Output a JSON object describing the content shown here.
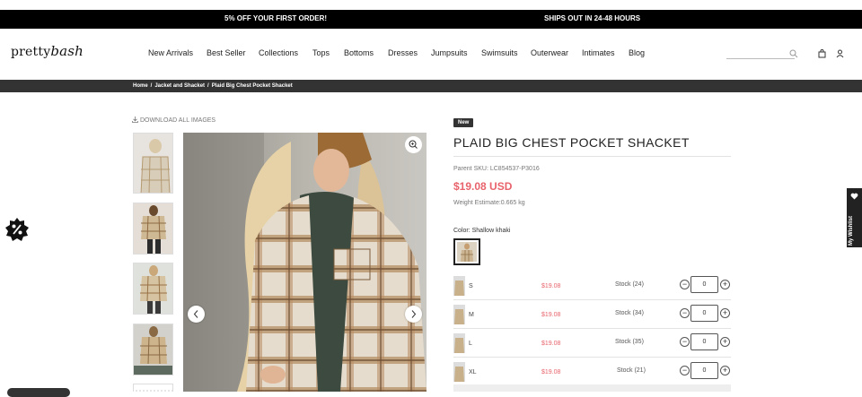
{
  "announcement": {
    "left": "5% OFF YOUR FIRST ORDER!",
    "right": "SHIPS OUT IN 24-48 HOURS"
  },
  "logo": {
    "part1": "pretty",
    "part2": "bash"
  },
  "nav": [
    "New Arrivals",
    "Best Seller",
    "Collections",
    "Tops",
    "Bottoms",
    "Dresses",
    "Jumpsuits",
    "Swimsuits",
    "Outerwear",
    "Intimates",
    "Blog"
  ],
  "icons": {
    "search": "search-icon",
    "cart": "shopping-bag-icon",
    "account": "user-icon",
    "zoom": "zoom-in-icon",
    "download": "download-icon",
    "promo": "percent-badge-icon",
    "wishlist": "heart-icon"
  },
  "breadcrumb": [
    "Home",
    "Jacket and Shacket",
    "Plaid Big Chest Pocket Shacket"
  ],
  "gallery": {
    "download_label": "DOWNLOAD ALL IMAGES"
  },
  "product": {
    "badge": "New",
    "title": "PLAID BIG CHEST POCKET SHACKET",
    "sku": "Parent SKU: LC854537-P3016",
    "price": "$19.08 USD",
    "weight": "Weight Estimate:0.665 kg",
    "color_label": "Color: Shallow khaki"
  },
  "variants": [
    {
      "size": "S",
      "price": "$19.08",
      "stock": "Stock (24)",
      "qty": "0"
    },
    {
      "size": "M",
      "price": "$19.08",
      "stock": "Stock (34)",
      "qty": "0"
    },
    {
      "size": "L",
      "price": "$19.08",
      "stock": "Stock (35)",
      "qty": "0"
    },
    {
      "size": "XL",
      "price": "$19.08",
      "stock": "Stock (21)",
      "qty": "0"
    }
  ],
  "wishlist_label": "My Wishlist",
  "colors": {
    "accent_price": "#e8636b",
    "bar_dark": "#000000",
    "breadcrumb_bg": "#333333"
  }
}
